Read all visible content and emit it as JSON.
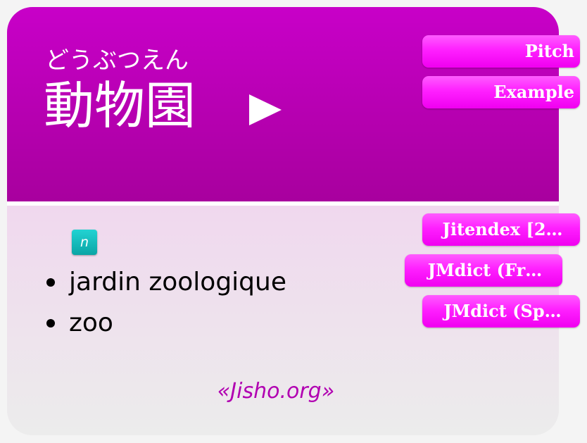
{
  "entry": {
    "reading": "どうぶつえん",
    "expression": "動物園",
    "part_of_speech_tag": "n",
    "definitions": [
      "jardin zoologique",
      "zoo"
    ],
    "source": "«Jisho.org»"
  },
  "buttons": {
    "pitch": "Pitch",
    "example": "Example",
    "jitendex": "Jitendex [2…",
    "jmdict_fr": "JMdict (Fr…",
    "jmdict_sp": "JMdict (Sp…"
  },
  "colors": {
    "header_top": "#c800c8",
    "header_bottom": "#a8009e",
    "button_accent": "#ff20ff",
    "tag_teal": "#0aa5a5",
    "source_text": "#b100b1"
  },
  "icons": {
    "play": "play-triangle-icon"
  }
}
